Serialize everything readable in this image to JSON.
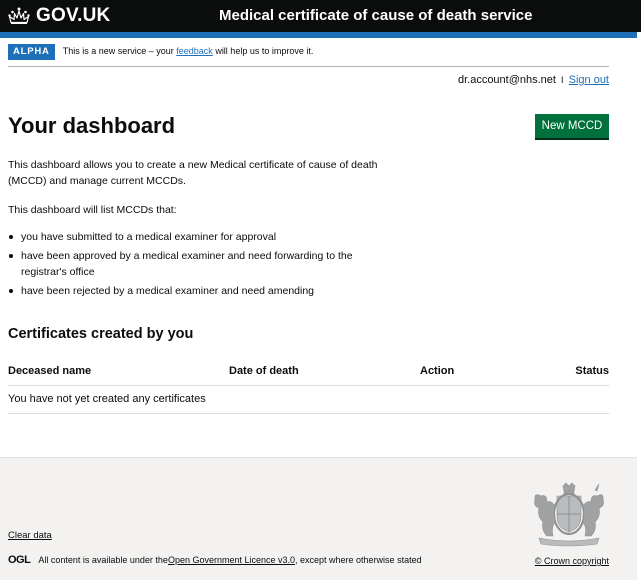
{
  "header": {
    "logo_text": "GOV.UK",
    "logo_icon": "crown-icon",
    "service_name": "Medical certificate of cause of death service"
  },
  "phase_banner": {
    "tag": "ALPHA",
    "text_before": "This is a new service – your ",
    "link": "feedback",
    "text_after": " will help us to improve it."
  },
  "account": {
    "email": "dr.account@nhs.net",
    "separator": "I",
    "sign_out": "Sign out"
  },
  "main": {
    "title": "Your dashboard",
    "new_button": "New MCCD",
    "intro": "This dashboard allows you to create a new Medical certificate of cause of death (MCCD) and manage current MCCDs.",
    "list_intro": "This dashboard will list MCCDs that:",
    "list_items": [
      "you have submitted to a medical examiner for approval",
      "have been approved by a medical examiner and need forwarding to the registrar's office",
      "have been rejected by a medical examiner and need amending"
    ],
    "section_title": "Certificates created by you",
    "table": {
      "headers": [
        "Deceased name",
        "Date of death",
        "Action",
        "Status"
      ],
      "empty_message": "You have not yet created any certificates"
    }
  },
  "footer": {
    "clear_data": "Clear data",
    "ogl_logo": "OGL",
    "licence_before": "All content is available under the ",
    "licence_link": "Open Government Licence v3.0",
    "licence_after": ", except where otherwise stated",
    "copyright": "© Crown copyright",
    "crest_icon": "royal-coat-of-arms-icon"
  },
  "colors": {
    "header_bg": "#0b0c0c",
    "brand_blue": "#1d70b8",
    "button_green": "#00703c",
    "footer_bg": "#f3f2f1"
  }
}
